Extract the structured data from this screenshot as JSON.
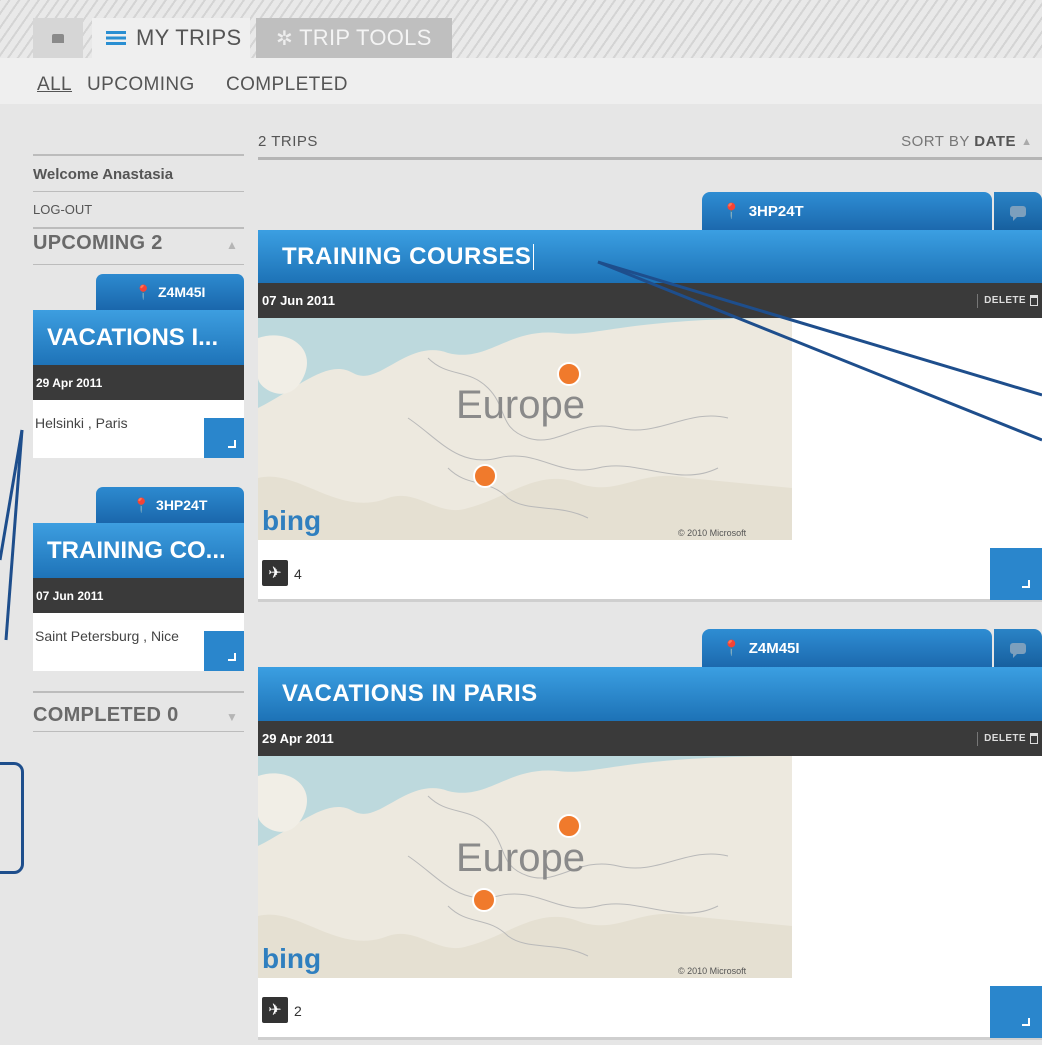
{
  "tabs": {
    "home_label": "",
    "my_trips": "MY TRIPS",
    "trip_tools": "TRIP TOOLS"
  },
  "filters": [
    "ALL",
    "UPCOMING",
    "COMPLETED"
  ],
  "sidebar": {
    "welcome": "Welcome Anastasia",
    "logout": "LOG-OUT",
    "upcoming_label": "UPCOMING 2",
    "completed_label": "COMPLETED 0",
    "trips": [
      {
        "code": "Z4M45I",
        "title": "VACATIONS I...",
        "date": "29 Apr 2011",
        "cities": "Helsinki , Paris"
      },
      {
        "code": "3HP24T",
        "title": "TRAINING CO...",
        "date": "07 Jun 2011",
        "cities": "Saint Petersburg , Nice"
      }
    ]
  },
  "list": {
    "count": "2 TRIPS",
    "sort_prefix": "SORT BY ",
    "sort_field": "DATE"
  },
  "cards": [
    {
      "code": "3HP24T",
      "title": "TRAINING COURSES",
      "date": "07 Jun 2011",
      "delete": "DELETE",
      "flights": "4",
      "map_label": "Europe",
      "map_brand": "bing",
      "map_copyright": "© 2010 Microsoft"
    },
    {
      "code": "Z4M45I",
      "title": "VACATIONS IN PARIS",
      "date": "29 Apr 2011",
      "delete": "DELETE",
      "flights": "2",
      "map_label": "Europe",
      "map_brand": "bing",
      "map_copyright": "© 2010 Microsoft"
    }
  ],
  "colors": {
    "accent": "#1e73b8",
    "dark_bar": "#3a3a3a",
    "marker": "#f07a2c",
    "annotation": "#1e4e8c"
  }
}
